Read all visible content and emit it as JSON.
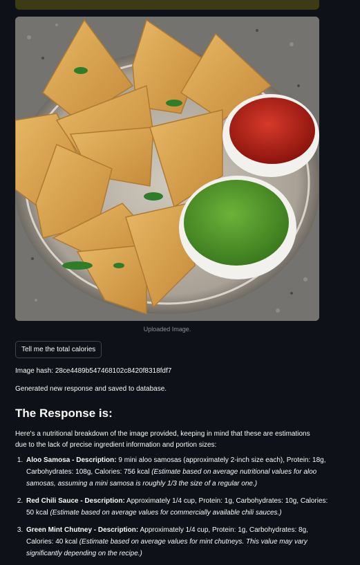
{
  "image": {
    "caption": "Uploaded Image.",
    "subject": "samosas-with-chutneys"
  },
  "actions": {
    "calories_button_label": "Tell me the total calories"
  },
  "status": {
    "hash_line": "Image hash: 28ce4489b547468102c8420f8318fdf7",
    "saved_line": "Generated new response and saved to database."
  },
  "response": {
    "heading": "The Response is:",
    "intro": "Here's a nutritional breakdown of the image provided, keeping in mind that these are estimations due to the lack of precise ingredient information and portion sizes:",
    "items": [
      {
        "title": "Aloo Samosa - Description:",
        "text": " 9 mini aloo samosas (approximately 2-inch size each), Protein: 18g, Carbohydrates: 108g, Calories: 756 kcal ",
        "note": "(Estimate based on average nutritional values for aloo samosas, assuming a mini samosa is roughly 1/3 the size of a regular one.)"
      },
      {
        "title": "Red Chili Sauce - Description:",
        "text": " Approximately 1/4 cup, Protein: 1g, Carbohydrates: 10g, Calories: 50 kcal ",
        "note": "(Estimate based on average values for commercially available chili sauces.)"
      },
      {
        "title": "Green Mint Chutney - Description:",
        "text": " Approximately 1/4 cup, Protein: 1g, Carbohydrates: 8g, Calories: 40 kcal ",
        "note": "(Estimate based on average values for mint chutneys. This value may vary significantly depending on the recipe.)"
      }
    ]
  },
  "colors": {
    "background": "#0e1117",
    "alert": "#3d3b15",
    "button_border": "#41444d"
  }
}
